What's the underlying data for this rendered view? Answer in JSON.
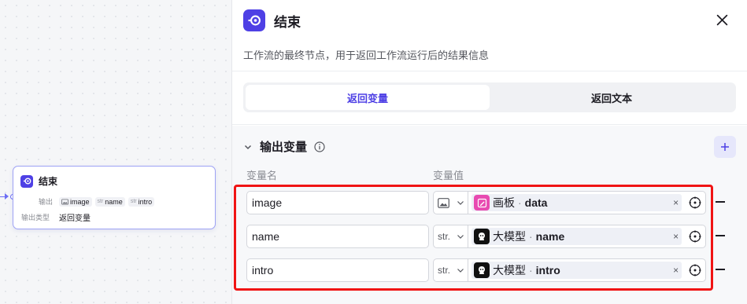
{
  "panel": {
    "title": "结束",
    "description": "工作流的最终节点，用于返回工作流运行后的结果信息",
    "tabs": [
      "返回变量",
      "返回文本"
    ],
    "section_title": "输出变量",
    "col_name": "变量名",
    "col_value": "变量值",
    "rows": [
      {
        "name": "image",
        "type": "",
        "source": "画板",
        "sep": "·",
        "var": "data"
      },
      {
        "name": "name",
        "type": "str.",
        "source": "大模型",
        "sep": "·",
        "var": "name"
      },
      {
        "name": "intro",
        "type": "str.",
        "source": "大模型",
        "sep": "·",
        "var": "intro"
      }
    ],
    "remove_glyph": "×"
  },
  "node": {
    "title": "结束",
    "output_label": "输出",
    "outputs": [
      {
        "type": "",
        "name": "image"
      },
      {
        "type": "str",
        "name": "name"
      },
      {
        "type": "str",
        "name": "intro"
      }
    ],
    "output_type_label": "输出类型",
    "output_type_value": "返回变量"
  },
  "colors": {
    "accent": "#4e40e5",
    "highlight": "#f01414",
    "canvas_node_border": "#9ea2f5",
    "drawing_icon": "#e84ab1"
  }
}
